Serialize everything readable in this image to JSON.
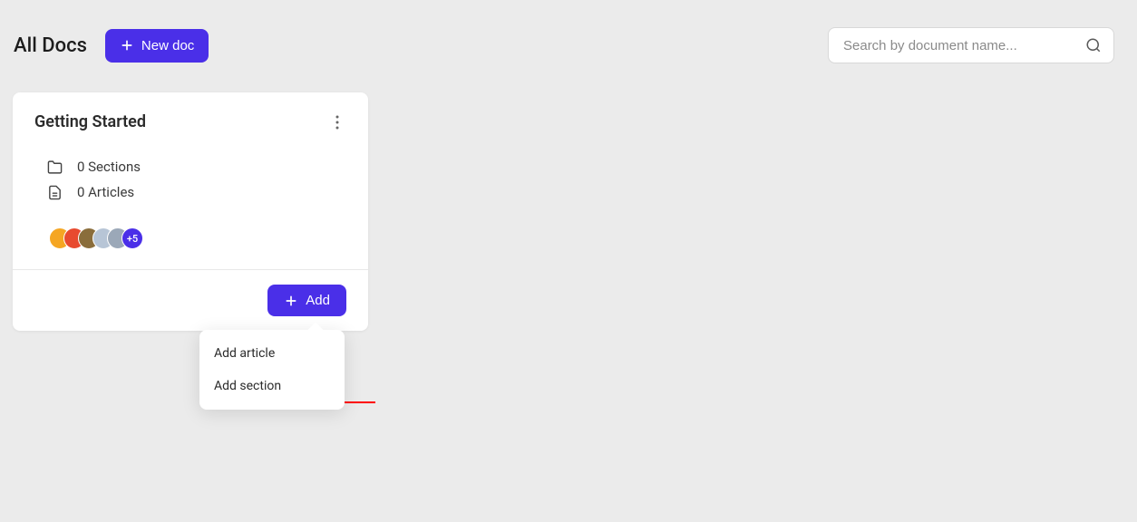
{
  "header": {
    "title": "All Docs",
    "new_doc_label": "New doc",
    "search_placeholder": "Search by document name..."
  },
  "card": {
    "title": "Getting Started",
    "sections_label": "0 Sections",
    "articles_label": "0 Articles",
    "avatars": [
      {
        "bg": "#f5a623"
      },
      {
        "bg": "#e84a2f"
      },
      {
        "bg": "#8a6d3b"
      },
      {
        "bg": "#b7c5d6"
      },
      {
        "bg": "#9ba8b8"
      }
    ],
    "avatar_overflow": "+5",
    "add_label": "Add"
  },
  "dropdown": {
    "items": [
      {
        "label": "Add article"
      },
      {
        "label": "Add section"
      }
    ]
  }
}
